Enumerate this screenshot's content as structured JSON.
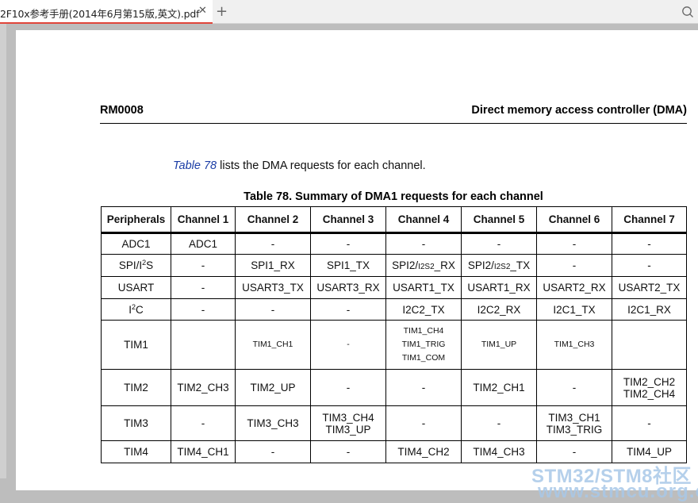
{
  "tab": {
    "title": "2F10x参考手册(2014年6月第15版,英文).pdf",
    "close_icon": "close-icon",
    "new_tab_icon": "plus-icon"
  },
  "toolbar": {
    "search_icon": "search-icon"
  },
  "document": {
    "header_left": "RM0008",
    "header_right": "Direct memory access controller (DMA)",
    "intro_ref": "Table 78",
    "intro_rest": " lists the DMA requests for each channel.",
    "caption": "Table 78. Summary of DMA1 requests for each channel",
    "table": {
      "columns": [
        "Peripherals",
        "Channel 1",
        "Channel 2",
        "Channel 3",
        "Channel 4",
        "Channel 5",
        "Channel 6",
        "Channel 7"
      ],
      "rows": [
        [
          "ADC1",
          "ADC1",
          "-",
          "-",
          "-",
          "-",
          "-",
          "-"
        ],
        [
          "SPI/I2S",
          "-",
          "SPI1_RX",
          "SPI1_TX",
          "SPI2/I2S2_RX",
          "SPI2/I2S2_TX",
          "-",
          "-"
        ],
        [
          "USART",
          "-",
          "USART3_TX",
          "USART3_RX",
          "USART1_TX",
          "USART1_RX",
          "USART2_RX",
          "USART2_TX"
        ],
        [
          "I2C",
          "-",
          "-",
          "-",
          "I2C2_TX",
          "I2C2_RX",
          "I2C1_TX",
          "I2C1_RX"
        ],
        [
          "TIM1",
          "",
          "TIM1_CH1",
          "-",
          "TIM1_CH4\nTIM1_TRIG\nTIM1_COM",
          "TIM1_UP",
          "TIM1_CH3",
          ""
        ],
        [
          "TIM2",
          "TIM2_CH3",
          "TIM2_UP",
          "-",
          "-",
          "TIM2_CH1",
          "-",
          "TIM2_CH2\nTIM2_CH4"
        ],
        [
          "TIM3",
          "-",
          "TIM3_CH3",
          "TIM3_CH4\nTIM3_UP",
          "-",
          "-",
          "TIM3_CH1\nTIM3_TRIG",
          "-"
        ],
        [
          "TIM4",
          "TIM4_CH1",
          "-",
          "-",
          "TIM4_CH2",
          "TIM4_CH3",
          "-",
          "TIM4_UP"
        ]
      ]
    }
  },
  "watermark": {
    "line1": "STM32/STM8社区",
    "line2": "www.stmcu.org.cn"
  },
  "colors": {
    "tab_accent": "#e0453a",
    "link": "#1a3ca5",
    "watermark": "#a9c8e8"
  }
}
